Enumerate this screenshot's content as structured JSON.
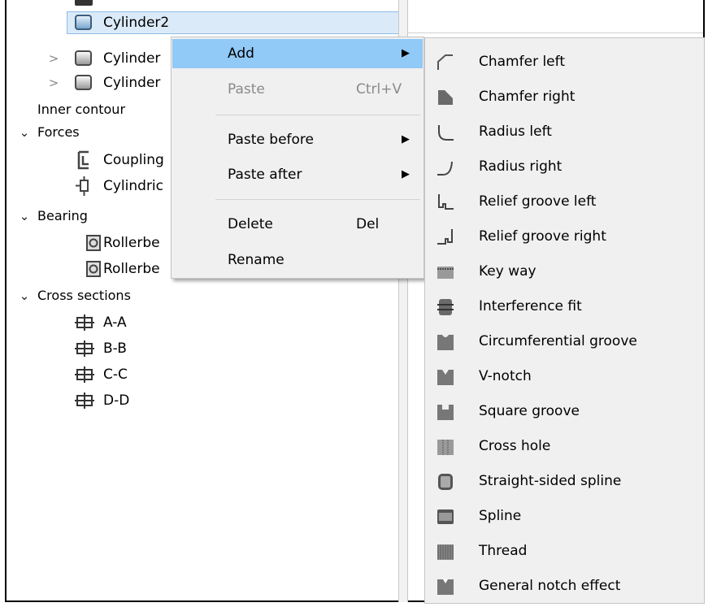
{
  "tree": {
    "selected_item": "Cylinder2",
    "items": [
      {
        "label": "Cylinder",
        "icon": "cylinder-icon",
        "chevron": ">"
      },
      {
        "label": "Cylinder",
        "icon": "cylinder-icon",
        "chevron": ">"
      },
      {
        "label": "Inner contour"
      },
      {
        "label": "Forces",
        "chevron": "v"
      },
      {
        "label": "Coupling",
        "icon": "coupling-icon"
      },
      {
        "label": "Cylindric",
        "icon": "cylindrical-force-icon"
      },
      {
        "label": "Bearing",
        "chevron": "v"
      },
      {
        "label": "Rollerbe",
        "icon": "roller-bearing-icon"
      },
      {
        "label": "Rollerbe",
        "icon": "roller-bearing-icon"
      },
      {
        "label": "Cross sections",
        "chevron": "v"
      },
      {
        "label": "A-A",
        "icon": "cross-section-icon"
      },
      {
        "label": "B-B",
        "icon": "cross-section-icon"
      },
      {
        "label": "C-C",
        "icon": "cross-section-icon"
      },
      {
        "label": "D-D",
        "icon": "cross-section-icon"
      }
    ],
    "chevron_closed": ">",
    "chevron_open": "⌄"
  },
  "context_menu": {
    "add": "Add",
    "paste": "Paste",
    "paste_shortcut": "Ctrl+V",
    "paste_before": "Paste before",
    "paste_after": "Paste after",
    "delete": "Delete",
    "delete_shortcut": "Del",
    "rename": "Rename",
    "submenu_arrow": "▶",
    "highlight_color": "#91c9f7"
  },
  "submenu": {
    "items": [
      {
        "label": "Chamfer left",
        "icon": "chamfer-left-icon"
      },
      {
        "label": "Chamfer right",
        "icon": "chamfer-right-icon"
      },
      {
        "label": "Radius left",
        "icon": "radius-left-icon"
      },
      {
        "label": "Radius right",
        "icon": "radius-right-icon"
      },
      {
        "label": "Relief groove left",
        "icon": "relief-groove-left-icon"
      },
      {
        "label": "Relief groove right",
        "icon": "relief-groove-right-icon"
      },
      {
        "label": "Key way",
        "icon": "key-way-icon"
      },
      {
        "label": "Interference fit",
        "icon": "interference-fit-icon"
      },
      {
        "label": "Circumferential groove",
        "icon": "circumferential-groove-icon"
      },
      {
        "label": "V-notch",
        "icon": "v-notch-icon"
      },
      {
        "label": "Square groove",
        "icon": "square-groove-icon"
      },
      {
        "label": "Cross hole",
        "icon": "cross-hole-icon"
      },
      {
        "label": "Straight-sided spline",
        "icon": "straight-sided-spline-icon"
      },
      {
        "label": "Spline",
        "icon": "spline-icon"
      },
      {
        "label": "Thread",
        "icon": "thread-icon"
      },
      {
        "label": "General notch effect",
        "icon": "general-notch-effect-icon"
      }
    ]
  }
}
